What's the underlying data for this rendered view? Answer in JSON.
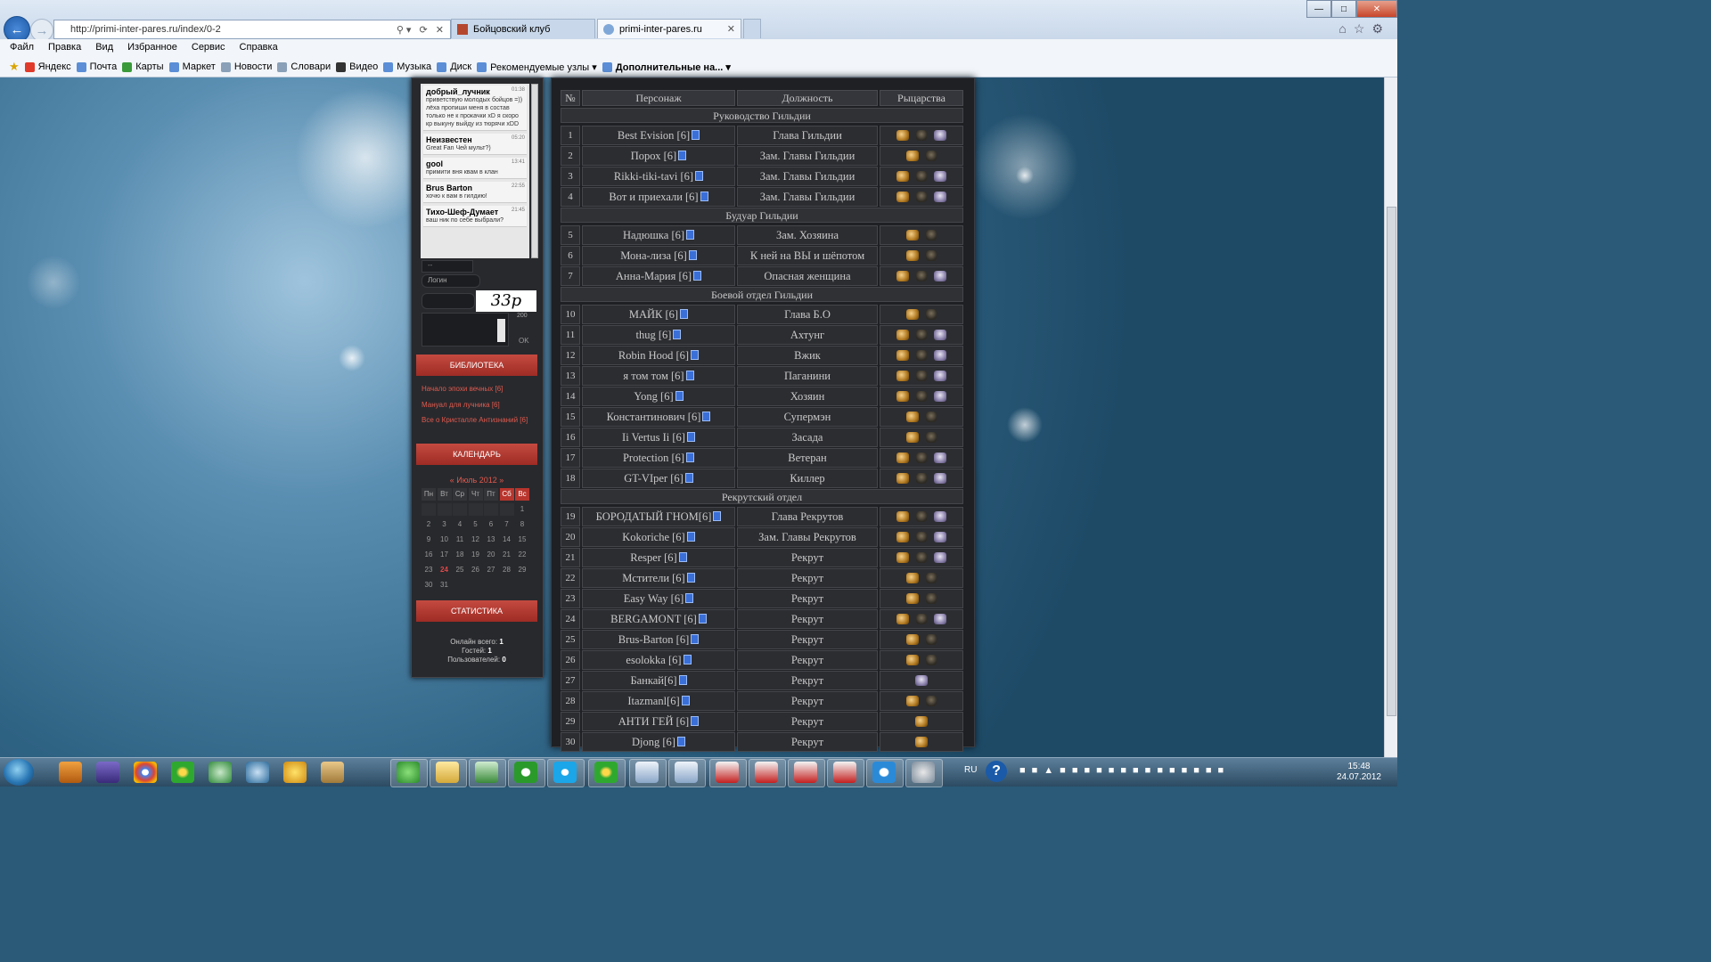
{
  "browser": {
    "url": "http://primi-inter-pares.ru/index/0-2",
    "tabs": [
      {
        "label": "Бойцовский клуб",
        "active": false
      },
      {
        "label": "primi-inter-pares.ru",
        "active": true
      }
    ],
    "menu": [
      "Файл",
      "Правка",
      "Вид",
      "Избранное",
      "Сервис",
      "Справка"
    ],
    "favorites": [
      "Яндекс",
      "Почта",
      "Карты",
      "Маркет",
      "Новости",
      "Словари",
      "Видео",
      "Музыка",
      "Диск",
      "Рекомендуемые узлы ▾",
      "Дополнительные на... ▾"
    ]
  },
  "sidebar": {
    "chat": [
      {
        "name": "добрый_лучник",
        "time": "01:38",
        "text": "приветствую молодых бойцов =)) лёха пропиши меня в состав только не к прокачки xD я скоро кр выкуну выйду из тюрячи xDD"
      },
      {
        "name": "Неизвестен",
        "time": "05:20",
        "text": "Great Fan Чей мульт?)"
      },
      {
        "name": "gool",
        "time": "13:41",
        "text": "примити вня квам в клан"
      },
      {
        "name": "Brus Barton",
        "time": "22:55",
        "text": "хочю к вам в гилдию!"
      },
      {
        "name": "Тихо-Шеф-Думает",
        "time": "21:45",
        "text": "ваш ник по себе выбрали?"
      }
    ],
    "smile_select": "--",
    "login_placeholder": "Логин",
    "captcha": "33p",
    "char_counter": "200",
    "ok_label": "OK",
    "library": {
      "title": "БИБЛИОТЕКА",
      "links": [
        "Начало эпохи вечных [6]",
        "Мануал для лучника [6]",
        "Все о Кристалле Антизнаний [6]"
      ]
    },
    "calendar": {
      "title": "КАЛЕНДАРЬ",
      "month": "«  Июль 2012  »",
      "weekdays": [
        "Пн",
        "Вт",
        "Ср",
        "Чт",
        "Пт",
        "Сб",
        "Вс"
      ],
      "today": 24
    },
    "stats": {
      "title": "СТАТИСТИКА",
      "online_label": "Онлайн всего:",
      "online": "1",
      "guests_label": "Гостей:",
      "guests": "1",
      "users_label": "Пользователей:",
      "users": "0"
    }
  },
  "table": {
    "headers": [
      "№",
      "Персонаж",
      "Должность",
      "Рыцарства"
    ],
    "groups": [
      {
        "title": "Руководство Гильдии",
        "rows": [
          {
            "n": "1",
            "name": "Best Evision [6]",
            "role": "Глава Гильдии",
            "icons": [
              "h",
              "s",
              "g"
            ]
          },
          {
            "n": "2",
            "name": "Порох [6]",
            "role": "Зам. Главы Гильдии",
            "icons": [
              "h",
              "s"
            ]
          },
          {
            "n": "3",
            "name": "Rikki-tiki-tavi [6]",
            "role": "Зам. Главы Гильдии",
            "icons": [
              "h",
              "s",
              "g"
            ]
          },
          {
            "n": "4",
            "name": "Вот и приехали [6]",
            "role": "Зам. Главы Гильдии",
            "icons": [
              "h",
              "s",
              "g"
            ]
          }
        ]
      },
      {
        "title": "Будуар Гильдии",
        "rows": [
          {
            "n": "5",
            "name": "Надюшка [6]",
            "role": "Зам. Хозяина",
            "icons": [
              "h",
              "s"
            ]
          },
          {
            "n": "6",
            "name": "Мона-лиза [6]",
            "role": "К ней на ВЫ и шёпотом",
            "icons": [
              "h",
              "s"
            ]
          },
          {
            "n": "7",
            "name": "Анна-Мария [6]",
            "role": "Опасная женщина",
            "icons": [
              "h",
              "s",
              "g"
            ]
          }
        ]
      },
      {
        "title": "Боевой отдел Гильдии",
        "rows": [
          {
            "n": "10",
            "name": "МАЙК [6]",
            "role": "Глава Б.О",
            "icons": [
              "h",
              "s"
            ]
          },
          {
            "n": "11",
            "name": "thug [6]",
            "role": "Ахтунг",
            "icons": [
              "h",
              "s",
              "g"
            ]
          },
          {
            "n": "12",
            "name": "Robin Hood [6]",
            "role": "Вжик",
            "icons": [
              "h",
              "s",
              "g"
            ]
          },
          {
            "n": "13",
            "name": "я том том [6]",
            "role": "Паганини",
            "icons": [
              "h",
              "s",
              "g"
            ]
          },
          {
            "n": "14",
            "name": "Yong [6]",
            "role": "Хозяин",
            "icons": [
              "h",
              "s",
              "g"
            ]
          },
          {
            "n": "15",
            "name": "Константинович [6]",
            "role": "Супермэн",
            "icons": [
              "h",
              "s"
            ]
          },
          {
            "n": "16",
            "name": "Ii Vertus Ii [6]",
            "role": "Засада",
            "icons": [
              "h",
              "s"
            ]
          },
          {
            "n": "17",
            "name": "Protection [6]",
            "role": "Ветеран",
            "icons": [
              "h",
              "s",
              "g"
            ]
          },
          {
            "n": "18",
            "name": "GT-VIper [6]",
            "role": "Киллер",
            "icons": [
              "h",
              "s",
              "g"
            ]
          }
        ]
      },
      {
        "title": "Рекрутский отдел",
        "rows": [
          {
            "n": "19",
            "name": "БОРОДАТЫЙ ГНОМ[6]",
            "role": "Глава Рекрутов",
            "icons": [
              "h",
              "s",
              "g"
            ]
          },
          {
            "n": "20",
            "name": "Kokoriche [6]",
            "role": "Зам. Главы Рекрутов",
            "icons": [
              "h",
              "s",
              "g"
            ]
          },
          {
            "n": "21",
            "name": "Resper [6]",
            "role": "Рекрут",
            "icons": [
              "h",
              "s",
              "g"
            ]
          },
          {
            "n": "22",
            "name": "Мстители [6]",
            "role": "Рекрут",
            "icons": [
              "h",
              "s"
            ]
          },
          {
            "n": "23",
            "name": "Easy Way [6]",
            "role": "Рекрут",
            "icons": [
              "h",
              "s"
            ]
          },
          {
            "n": "24",
            "name": "BERGAMONT [6]",
            "role": "Рекрут",
            "icons": [
              "h",
              "s",
              "g"
            ]
          },
          {
            "n": "25",
            "name": "Brus-Barton [6]",
            "role": "Рекрут",
            "icons": [
              "h",
              "s"
            ]
          },
          {
            "n": "26",
            "name": "esolokka [6]",
            "role": "Рекрут",
            "icons": [
              "h",
              "s"
            ]
          },
          {
            "n": "27",
            "name": "Банкай[6]",
            "role": "Рекрут",
            "icons": [
              "g"
            ]
          },
          {
            "n": "28",
            "name": "Itazmanl[6]",
            "role": "Рекрут",
            "icons": [
              "h",
              "s"
            ]
          },
          {
            "n": "29",
            "name": "АНТИ ГЕЙ [6]",
            "role": "Рекрут",
            "icons": [
              "h"
            ]
          },
          {
            "n": "30",
            "name": "Djong [6]",
            "role": "Рекрут",
            "icons": [
              "h"
            ]
          }
        ]
      }
    ]
  },
  "taskbar": {
    "lang": "RU",
    "time": "15:48",
    "date": "24.07.2012"
  }
}
